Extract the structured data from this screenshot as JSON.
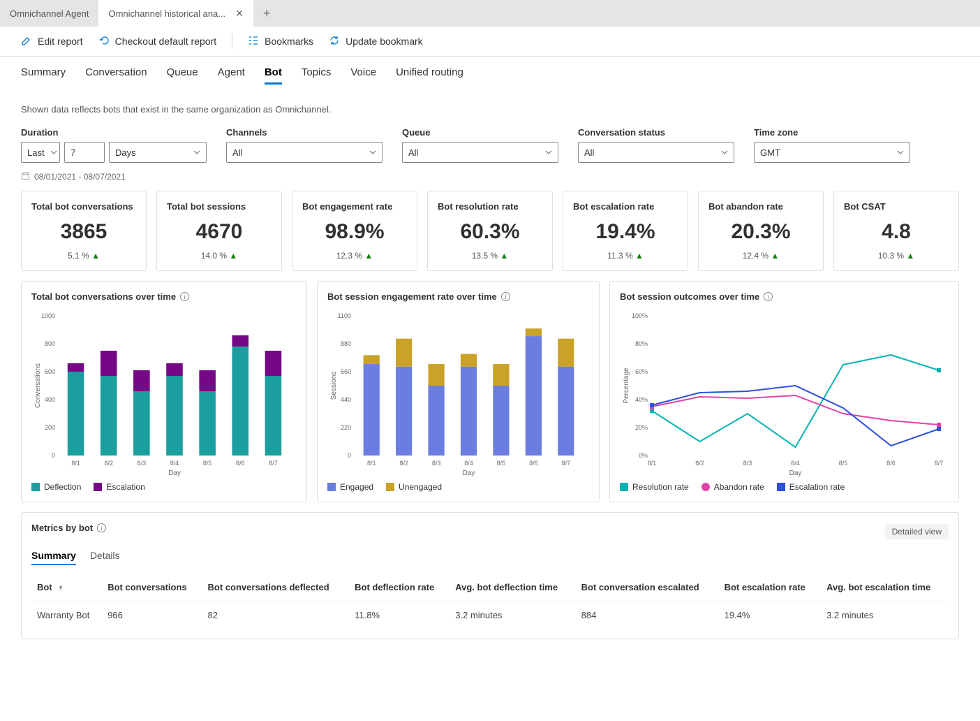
{
  "tabs": {
    "inactive": "Omnichannel Agent",
    "active": "Omnichannel historical ana..."
  },
  "toolbar": {
    "edit": "Edit report",
    "checkout": "Checkout default report",
    "bookmarks": "Bookmarks",
    "update": "Update bookmark"
  },
  "subnav": [
    "Summary",
    "Conversation",
    "Queue",
    "Agent",
    "Bot",
    "Topics",
    "Voice",
    "Unified routing"
  ],
  "subnav_active": "Bot",
  "info_text": "Shown data reflects bots that exist in the same organization as Omnichannel.",
  "filters": {
    "duration": {
      "label": "Duration",
      "mode": "Last",
      "value": "7",
      "unit": "Days"
    },
    "channels": {
      "label": "Channels",
      "value": "All"
    },
    "queue": {
      "label": "Queue",
      "value": "All"
    },
    "status": {
      "label": "Conversation status",
      "value": "All"
    },
    "timezone": {
      "label": "Time zone",
      "value": "GMT"
    }
  },
  "date_range": "08/01/2021 - 08/07/2021",
  "kpis": [
    {
      "title": "Total bot conversations",
      "value": "3865",
      "delta": "5.1 %"
    },
    {
      "title": "Total bot sessions",
      "value": "4670",
      "delta": "14.0 %"
    },
    {
      "title": "Bot engagement rate",
      "value": "98.9%",
      "delta": "12.3 %"
    },
    {
      "title": "Bot resolution rate",
      "value": "60.3%",
      "delta": "13.5 %"
    },
    {
      "title": "Bot escalation rate",
      "value": "19.4%",
      "delta": "11.3 %"
    },
    {
      "title": "Bot abandon rate",
      "value": "20.3%",
      "delta": "12.4 %"
    },
    {
      "title": "Bot CSAT",
      "value": "4.8",
      "delta": "10.3 %"
    }
  ],
  "chart1": {
    "title": "Total bot conversations over time",
    "legend": [
      "Deflection",
      "Escalation"
    ]
  },
  "chart2": {
    "title": "Bot session engagement rate over time",
    "legend": [
      "Engaged",
      "Unengaged"
    ]
  },
  "chart3": {
    "title": "Bot session outcomes over time",
    "legend": [
      "Resolution rate",
      "Abandon rate",
      "Escalation rate"
    ]
  },
  "table": {
    "title": "Metrics by bot",
    "detailed": "Detailed view",
    "tabs": [
      "Summary",
      "Details"
    ],
    "headers": [
      "Bot",
      "Bot conversations",
      "Bot conversations deflected",
      "Bot deflection rate",
      "Avg. bot deflection time",
      "Bot conversation escalated",
      "Bot escalation rate",
      "Avg. bot escalation time"
    ],
    "rows": [
      [
        "Warranty Bot",
        "966",
        "82",
        "11.8%",
        "3.2 minutes",
        "884",
        "19.4%",
        "3.2 minutes"
      ]
    ]
  },
  "chart_data": [
    {
      "type": "bar",
      "title": "Total bot conversations over time",
      "xlabel": "Day",
      "ylabel": "Conversations",
      "ylim": [
        0,
        1000
      ],
      "categories": [
        "8/1",
        "8/2",
        "8/3",
        "8/4",
        "8/5",
        "8/6",
        "8/7"
      ],
      "series": [
        {
          "name": "Deflection",
          "values": [
            600,
            570,
            460,
            570,
            460,
            780,
            570
          ],
          "color": "#118DFF"
        },
        {
          "name": "Escalation",
          "values": [
            60,
            180,
            150,
            90,
            150,
            80,
            180
          ],
          "color": "#750985"
        }
      ]
    },
    {
      "type": "bar",
      "title": "Bot session engagement rate over time",
      "xlabel": "Day",
      "ylabel": "Sessions",
      "ylim": [
        0,
        1100
      ],
      "categories": [
        "8/1",
        "8/2",
        "8/3",
        "8/4",
        "8/5",
        "8/6",
        "8/7"
      ],
      "series": [
        {
          "name": "Engaged",
          "values": [
            720,
            700,
            550,
            700,
            550,
            940,
            700
          ],
          "color": "#6B7DDF"
        },
        {
          "name": "Unengaged",
          "values": [
            70,
            220,
            170,
            100,
            170,
            60,
            220
          ],
          "color": "#C9A227"
        }
      ]
    },
    {
      "type": "line",
      "title": "Bot session outcomes over time",
      "xlabel": "Day",
      "ylabel": "Percentage",
      "ylim": [
        0,
        100
      ],
      "categories": [
        "8/1",
        "8/2",
        "8/3",
        "8/4",
        "8/5",
        "8/6",
        "8/7"
      ],
      "series": [
        {
          "name": "Resolution rate",
          "values": [
            32,
            10,
            30,
            6,
            65,
            72,
            61
          ],
          "color": "#04B2B2"
        },
        {
          "name": "Abandon rate",
          "values": [
            35,
            42,
            41,
            43,
            30,
            25,
            22
          ],
          "color": "#E044A7"
        },
        {
          "name": "Escalation rate",
          "values": [
            36,
            45,
            46,
            50,
            34,
            7,
            19
          ],
          "color": "#2E4FE0"
        }
      ]
    }
  ]
}
